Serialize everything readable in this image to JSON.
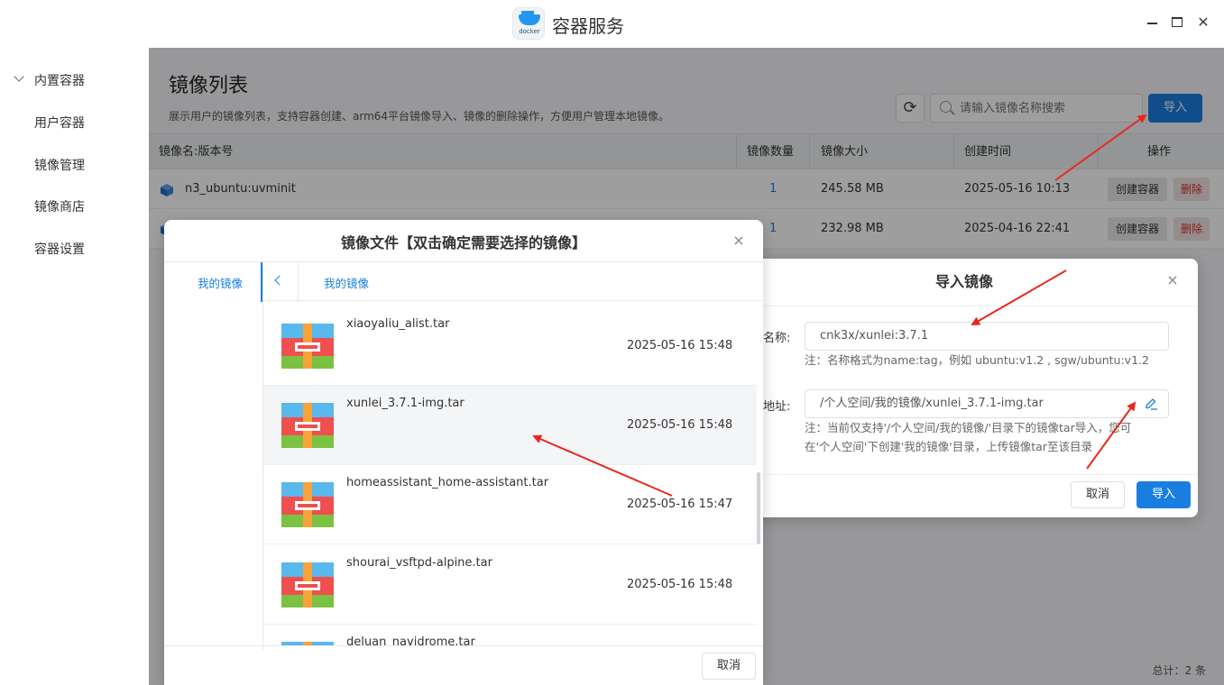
{
  "window": {
    "title": "容器服务",
    "logo_text": "docker"
  },
  "sidebar": {
    "items": [
      {
        "label": "内置容器"
      },
      {
        "label": "用户容器"
      },
      {
        "label": "镜像管理"
      },
      {
        "label": "镜像商店"
      },
      {
        "label": "容器设置"
      }
    ]
  },
  "page": {
    "title": "镜像列表",
    "description": "展示用户的镜像列表，支持容器创建、arm64平台镜像导入、镜像的删除操作，方便用户管理本地镜像。",
    "search_placeholder": "请输入镜像名称搜索",
    "import_label": "导入",
    "total": "总计：2 条"
  },
  "table": {
    "columns": [
      "镜像名:版本号",
      "镜像数量",
      "镜像大小",
      "创建时间",
      "操作"
    ],
    "rows": [
      {
        "name": "n3_ubuntu:uvminit",
        "count": "1",
        "size": "245.58 MB",
        "created": "2025-05-16 10:13",
        "create_label": "创建容器",
        "delete_label": "删除"
      },
      {
        "name": "",
        "count": "1",
        "size": "232.98 MB",
        "created": "2025-04-16 22:41",
        "create_label": "创建容器",
        "delete_label": "删除"
      }
    ]
  },
  "import_dialog": {
    "title": "导入镜像",
    "name_label": "名称:",
    "name_value": "cnk3x/xunlei:3.7.1",
    "name_note": "注：名称格式为name:tag，例如 ubuntu:v1.2 , sgw/ubuntu:v1.2",
    "path_label": "地址:",
    "path_value": "/个人空间/我的镜像/xunlei_3.7.1-img.tar",
    "path_note_1": "注：当前仅支持'/个人空间/我的镜像/'目录下的镜像tar导入，您可",
    "path_note_2": "在'个人空间'下创建'我的镜像'目录，上传镜像tar至该目录",
    "cancel_label": "取消",
    "confirm_label": "导入"
  },
  "file_dialog": {
    "title": "镜像文件【双击确定需要选择的镜像】",
    "nav_label": "我的镜像",
    "breadcrumb": "我的镜像",
    "files": [
      {
        "name": "xiaoyaliu_alist.tar",
        "date": "2025-05-16 15:48"
      },
      {
        "name": "xunlei_3.7.1-img.tar",
        "date": "2025-05-16 15:48"
      },
      {
        "name": "homeassistant_home-assistant.tar",
        "date": "2025-05-16 15:47"
      },
      {
        "name": "shourai_vsftpd-alpine.tar",
        "date": "2025-05-16 15:48"
      },
      {
        "name": "deluan_navidrome.tar",
        "date": ""
      }
    ],
    "cancel_label": "取消"
  },
  "colors": {
    "accent": "#1a7ee0",
    "danger": "#d43030",
    "arrow": "#e8281e"
  }
}
